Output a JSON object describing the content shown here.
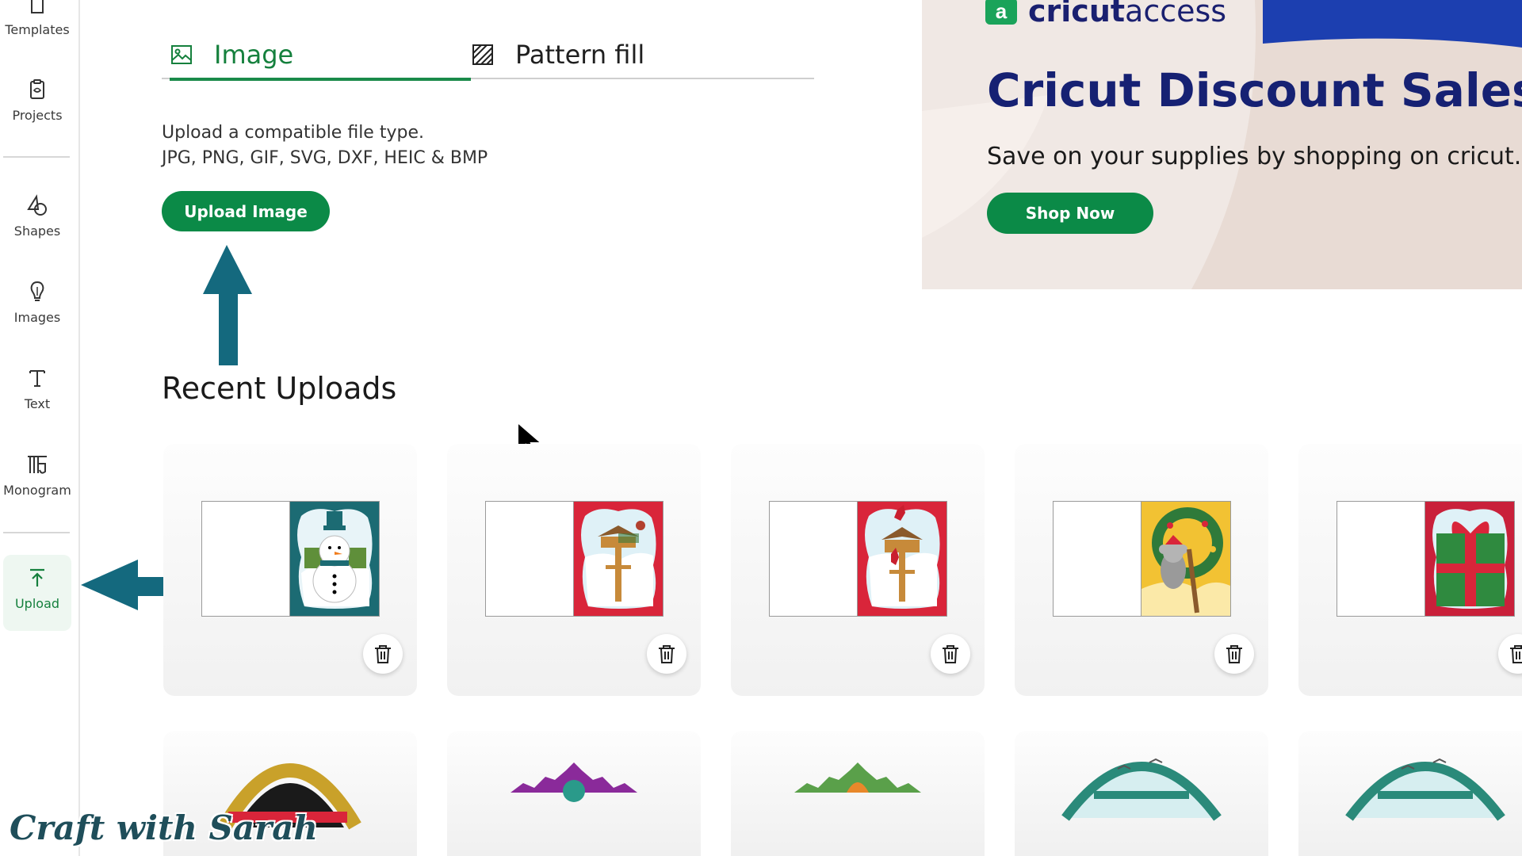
{
  "sidebar": {
    "items": [
      {
        "label": "Templates"
      },
      {
        "label": "Projects"
      },
      {
        "label": "Shapes"
      },
      {
        "label": "Images"
      },
      {
        "label": "Text"
      },
      {
        "label": "Monogram"
      },
      {
        "label": "Upload",
        "active": true
      }
    ]
  },
  "tabs": [
    {
      "label": "Image",
      "icon": "image-icon",
      "active": true
    },
    {
      "label": "Pattern fill",
      "icon": "pattern-fill-icon",
      "active": false
    }
  ],
  "upload": {
    "line1": "Upload a compatible file type.",
    "line2": "JPG, PNG, GIF, SVG, DXF, HEIC & BMP",
    "button_label": "Upload Image"
  },
  "recent": {
    "title": "Recent Uploads",
    "items": [
      {
        "name": "snowman",
        "art_color": "#1c6b73"
      },
      {
        "name": "robin-birdhouse",
        "art_color": "#d9253a"
      },
      {
        "name": "cardinal-birdhouse",
        "art_color": "#d9253a"
      },
      {
        "name": "koala-wreath",
        "art_color": "#f2c233"
      },
      {
        "name": "christmas-present",
        "art_color": "#c9203a"
      }
    ]
  },
  "ad": {
    "brand_letter": "a",
    "brand_bold": "cricut",
    "brand_light": "access",
    "title": "Cricut Discount Sales",
    "subtitle": "Save on your supplies by shopping on cricut.c",
    "button_label": "Shop Now"
  },
  "watermark": "Craft with Sarah",
  "colors": {
    "accent_green": "#0b8a47",
    "annotation_arrow": "#14697e",
    "ad_navy": "#162173",
    "ad_blue": "#1c3fb0"
  }
}
